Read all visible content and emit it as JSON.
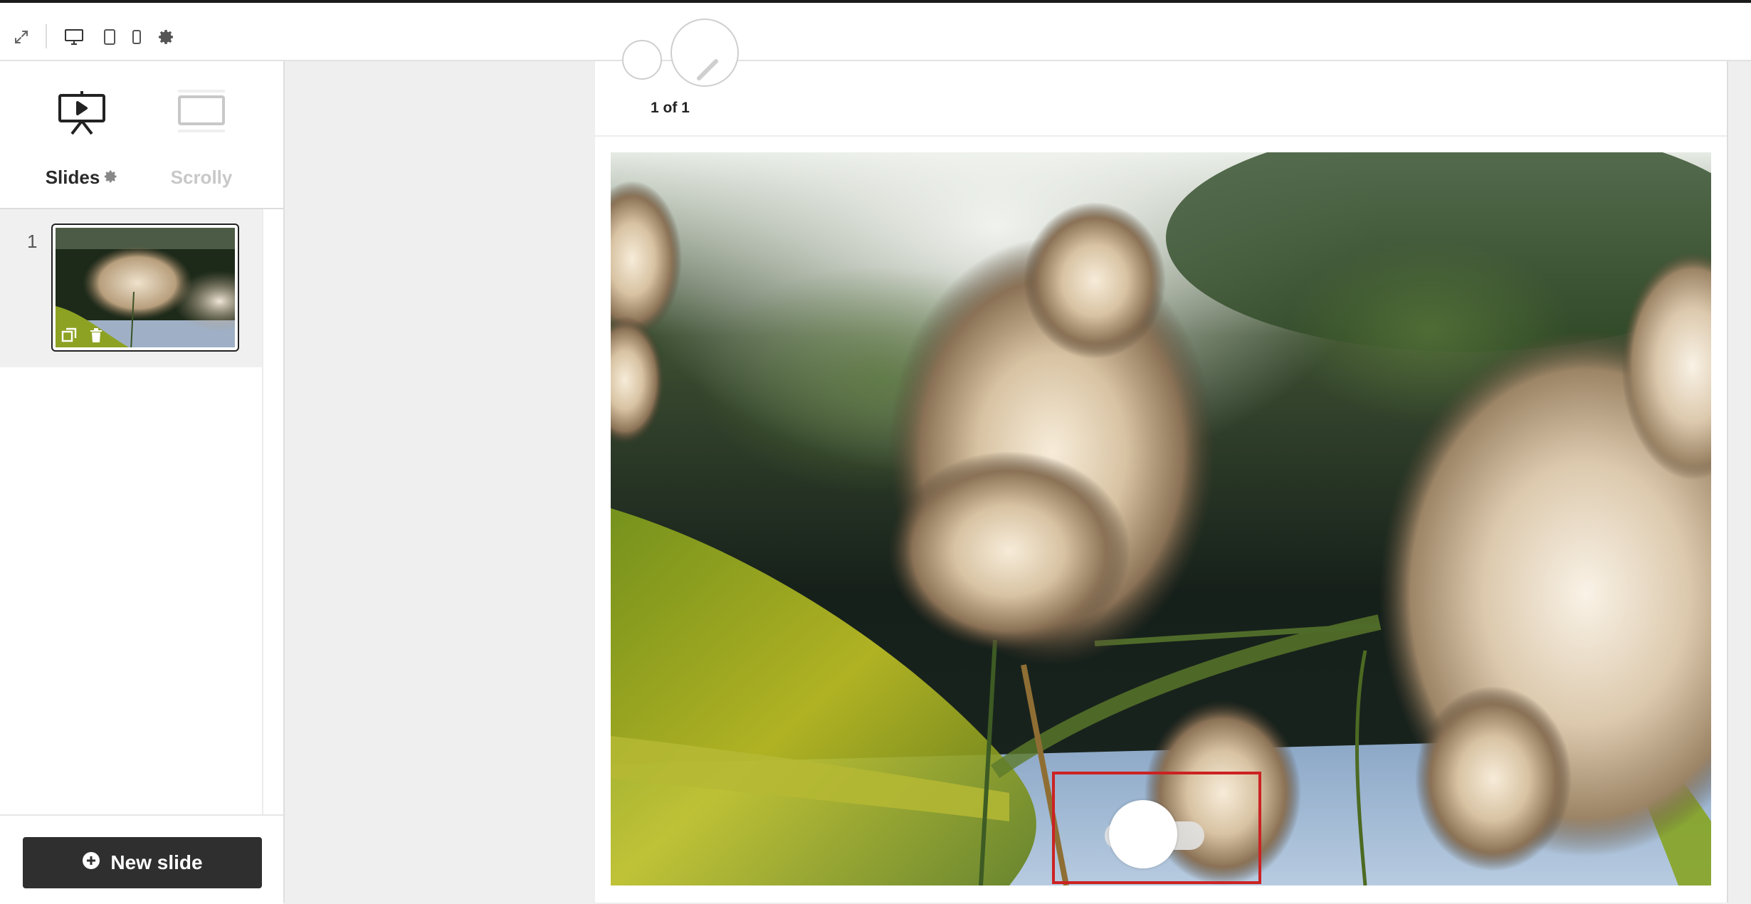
{
  "toolbar": {
    "icons": [
      "expand-icon",
      "desktop-icon",
      "tablet-icon",
      "mobile-icon",
      "gear-icon"
    ]
  },
  "sidebar": {
    "modes": [
      {
        "label": "Slides",
        "icon": "presentation-icon",
        "active": true,
        "settings_icon": "gear-icon"
      },
      {
        "label": "Scrolly",
        "icon": "scrolly-icon",
        "active": false
      }
    ],
    "slides": [
      {
        "number": "1",
        "actions": [
          "duplicate-icon",
          "trash-icon"
        ]
      }
    ],
    "new_slide_label": "New slide",
    "new_slide_icon": "plus-circle-icon"
  },
  "preview": {
    "page_count": "1 of 1",
    "toggle_state": "on"
  },
  "colors": {
    "dark": "#2f2f2f",
    "highlight": "#cc2222",
    "panel_bg": "#efefef"
  }
}
